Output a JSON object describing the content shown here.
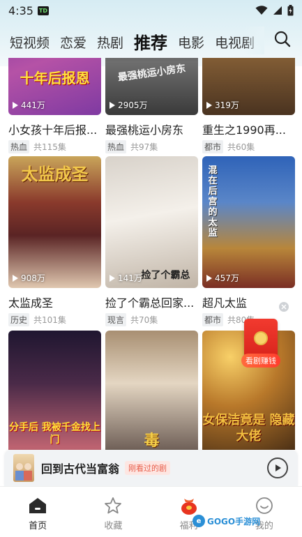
{
  "status": {
    "time": "4:35",
    "app_badge": "TD",
    "icons": [
      "wifi-icon",
      "cellular-icon",
      "battery-icon"
    ]
  },
  "tabs": [
    {
      "label": "短视频",
      "active": false
    },
    {
      "label": "恋爱",
      "active": false
    },
    {
      "label": "热剧",
      "active": false
    },
    {
      "label": "推荐",
      "active": true
    },
    {
      "label": "电影",
      "active": false
    },
    {
      "label": "电视剧",
      "active": false
    }
  ],
  "search_icon": "search-icon",
  "cards": [
    {
      "title": "小女孩十年后报...",
      "views": "441万",
      "tag": "热血",
      "episodes": "共115集",
      "poster_text": "十年后报恩",
      "colors": [
        "#7a3fb0",
        "#c55aa8"
      ]
    },
    {
      "title": "最强桃运小房东",
      "views": "2905万",
      "tag": "热血",
      "episodes": "共97集",
      "poster_text": "最强桃运小房东",
      "colors": [
        "#3a3a3a",
        "#8a8a8a"
      ]
    },
    {
      "title": "重生之1990再...",
      "views": "319万",
      "tag": "都市",
      "episodes": "共60集",
      "poster_text": "",
      "colors": [
        "#4a3520",
        "#9a7040"
      ]
    },
    {
      "title": "太监成圣",
      "views": "908万",
      "tag": "历史",
      "episodes": "共101集",
      "poster_text": "太监成圣",
      "colors": [
        "#7a2a2a",
        "#d8b46a"
      ]
    },
    {
      "title": "捡了个霸总回家...",
      "views": "141万",
      "tag": "现言",
      "episodes": "共70集",
      "poster_text": "捡了个霸总",
      "colors": [
        "#f0ece6",
        "#c8c0b6"
      ]
    },
    {
      "title": "超凡太监",
      "views": "457万",
      "tag": "都市",
      "episodes": "共80集",
      "poster_text": "混在后宫的太监",
      "colors": [
        "#2a5aa8",
        "#d8a840"
      ]
    },
    {
      "title": "",
      "views": "",
      "tag": "",
      "episodes": "",
      "poster_text": "分手后 我被千金找上门",
      "colors": [
        "#2a1a3a",
        "#c85a6a"
      ]
    },
    {
      "title": "",
      "views": "",
      "tag": "",
      "episodes": "",
      "poster_text": "毒",
      "colors": [
        "#b89a7a",
        "#e8d8c0"
      ]
    },
    {
      "title": "",
      "views": "",
      "tag": "",
      "episodes": "",
      "poster_text": "女保洁竟是 隐藏大佬",
      "colors": [
        "#5a3a1a",
        "#e8b040"
      ]
    }
  ],
  "red_packet": {
    "label": "看剧赚钱"
  },
  "recent": {
    "title": "回到古代当富翁",
    "badge": "刚看过的剧"
  },
  "bottom_nav": [
    {
      "label": "首页",
      "icon": "home-icon",
      "active": true
    },
    {
      "label": "收藏",
      "icon": "star-icon",
      "active": false
    },
    {
      "label": "福利",
      "icon": "gift-bag-icon",
      "active": false
    },
    {
      "label": "我的",
      "icon": "smiley-icon",
      "active": false
    }
  ],
  "watermark": "GOGO手游网"
}
